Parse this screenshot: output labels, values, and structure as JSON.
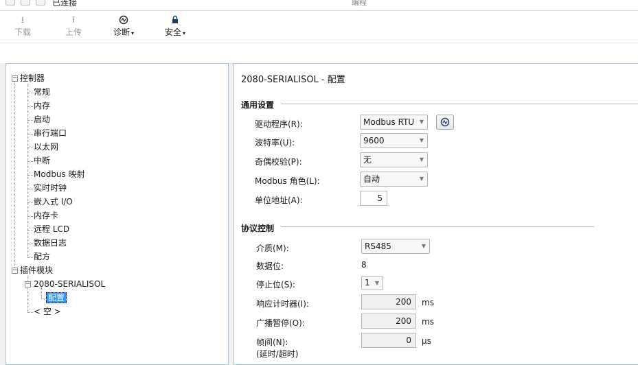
{
  "topbar": {
    "status_text": "已连接",
    "edit_text": "编程"
  },
  "toolbar": {
    "download": {
      "label": "下载",
      "icon": "download-icon"
    },
    "upload": {
      "label": "上传",
      "icon": "upload-icon"
    },
    "diagnose": {
      "label": "诊断",
      "icon": "diagnostics-icon"
    },
    "security": {
      "label": "安全",
      "icon": "lock-icon"
    }
  },
  "tree": {
    "controller": "控制器",
    "items": [
      "常规",
      "内存",
      "启动",
      "串行端口",
      "以太网",
      "中断",
      "Modbus 映射",
      "实时时钟",
      "嵌入式 I/O",
      "内存卡",
      "远程 LCD",
      "数据日志",
      "配方"
    ],
    "plugins": "插件模块",
    "module": "2080-SERIALISOL",
    "config": "配置",
    "empty": "< 空 >"
  },
  "panel": {
    "title": "2080-SERIALISOL - 配置",
    "general": {
      "header": "通用设置",
      "driver_label": "驱动程序(R):",
      "driver_value": "Modbus RTU",
      "baud_label": "波特率(U):",
      "baud_value": "9600",
      "parity_label": "奇偶校验(P):",
      "parity_value": "无",
      "role_label": "Modbus 角色(L):",
      "role_value": "自动",
      "unit_label": "单位地址(A):",
      "unit_value": "5"
    },
    "protocol": {
      "header": "协议控制",
      "medium_label": "介质(M):",
      "medium_value": "RS485",
      "databits_label": "数据位:",
      "databits_value": "8",
      "stopbits_label": "停止位(S):",
      "stopbits_value": "1",
      "resp_label": "响应计时器(I):",
      "resp_value": "200",
      "resp_unit": "ms",
      "bcast_label": "广播暂停(O):",
      "bcast_value": "200",
      "bcast_unit": "ms",
      "frame_label": "帧间(N):",
      "frame_label2": "(延时/超时)",
      "frame_value": "0",
      "frame_unit": "µs"
    }
  }
}
